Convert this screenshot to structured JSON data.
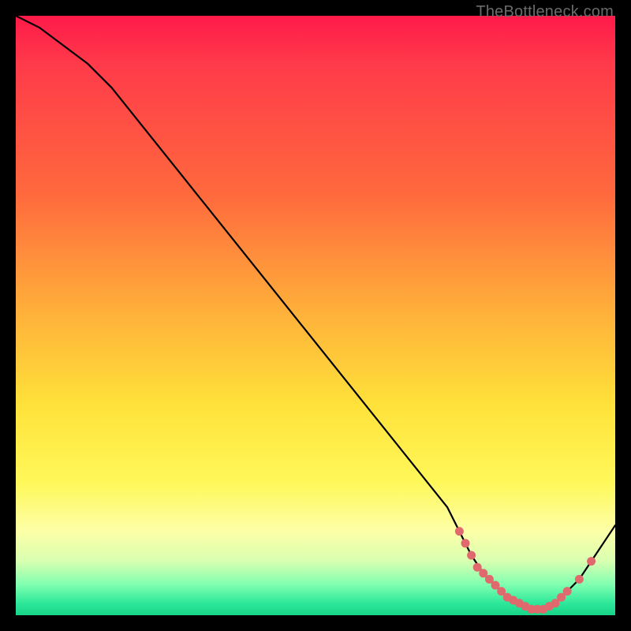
{
  "watermark": "TheBottleneck.com",
  "chart_data": {
    "type": "line",
    "title": "",
    "xlabel": "",
    "ylabel": "",
    "xlim": [
      0,
      100
    ],
    "ylim": [
      0,
      100
    ],
    "grid": false,
    "legend": false,
    "series": [
      {
        "name": "bottleneck-curve",
        "x": [
          0,
          4,
          8,
          12,
          16,
          20,
          24,
          28,
          32,
          36,
          40,
          44,
          48,
          52,
          56,
          60,
          64,
          68,
          72,
          74,
          76,
          78,
          80,
          82,
          84,
          86,
          88,
          90,
          92,
          94,
          96,
          98,
          100
        ],
        "values": [
          100,
          98,
          95,
          92,
          88,
          83,
          78,
          73,
          68,
          63,
          58,
          53,
          48,
          43,
          38,
          33,
          28,
          23,
          18,
          14,
          10,
          7,
          5,
          3,
          2,
          1,
          1,
          2,
          4,
          6,
          9,
          12,
          15
        ]
      }
    ],
    "markers": {
      "name": "highlight-dots",
      "x": [
        74,
        75,
        76,
        77,
        78,
        79,
        80,
        81,
        82,
        83,
        84,
        85,
        86,
        87,
        88,
        89,
        90,
        91,
        92,
        94,
        96
      ],
      "values": [
        14,
        12,
        10,
        8,
        7,
        6,
        5,
        4,
        3,
        2.5,
        2,
        1.5,
        1,
        1,
        1,
        1.5,
        2,
        3,
        4,
        6,
        9
      ]
    }
  }
}
